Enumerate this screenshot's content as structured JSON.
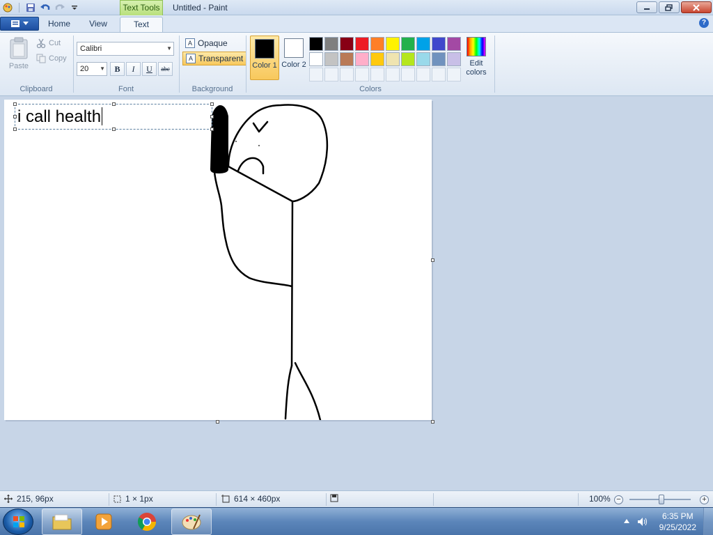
{
  "window": {
    "title": "Untitled - Paint",
    "context_tab": "Text Tools"
  },
  "tabs": [
    {
      "label": "Home"
    },
    {
      "label": "View"
    },
    {
      "label": "Text"
    }
  ],
  "ribbon": {
    "clipboard": {
      "label": "Clipboard",
      "paste": "Paste",
      "cut": "Cut",
      "copy": "Copy"
    },
    "font": {
      "label": "Font",
      "family": "Calibri",
      "size": "20",
      "bold": "B",
      "italic": "I",
      "underline": "U",
      "strike": "abc"
    },
    "background": {
      "label": "Background",
      "opaque": "Opaque",
      "transparent": "Transparent"
    },
    "colors": {
      "label": "Colors",
      "color1": "Color 1",
      "color1_value": "#000000",
      "color2": "Color 2",
      "color2_value": "#ffffff",
      "edit": "Edit colors",
      "palette_row1": [
        "#000000",
        "#7f7f7f",
        "#880015",
        "#ed1c24",
        "#ff7f27",
        "#fff200",
        "#22b14c",
        "#00a2e8",
        "#3f48cc",
        "#a349a4"
      ],
      "palette_row2": [
        "#ffffff",
        "#c3c3c3",
        "#b97a57",
        "#ffaec9",
        "#ffc90e",
        "#efe4b0",
        "#b5e61d",
        "#99d9ea",
        "#7092be",
        "#c8bfe7"
      ]
    }
  },
  "canvas": {
    "text": "i call health"
  },
  "status": {
    "cursor_pos": "215, 96px",
    "selection_size": "1 × 1px",
    "image_size": "614 × 460px",
    "zoom": "100%"
  },
  "taskbar": {
    "time": "6:35 PM",
    "date": "9/25/2022"
  }
}
